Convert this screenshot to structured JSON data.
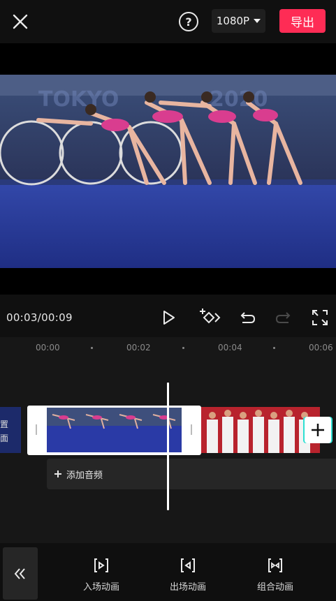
{
  "header": {
    "help_symbol": "?",
    "resolution": "1080P",
    "export_label": "导出"
  },
  "player": {
    "time_current": "00:03",
    "time_total": "00:09",
    "time_display": "00:03/00:09"
  },
  "timeline": {
    "ruler": [
      "00:00",
      "00:02",
      "00:04",
      "00:06"
    ],
    "left_clip_text": [
      "置",
      "面"
    ],
    "add_audio_label": "添加音频"
  },
  "bottom_tools": [
    {
      "label": "入场动画",
      "icon": "enter-animation-icon"
    },
    {
      "label": "出场动画",
      "icon": "exit-animation-icon"
    },
    {
      "label": "组合动画",
      "icon": "combo-animation-icon"
    }
  ],
  "colors": {
    "export": "#fe2c55",
    "background": "#101010",
    "timeline": "#171717",
    "add_clip_accent": "#2ce0d2"
  }
}
